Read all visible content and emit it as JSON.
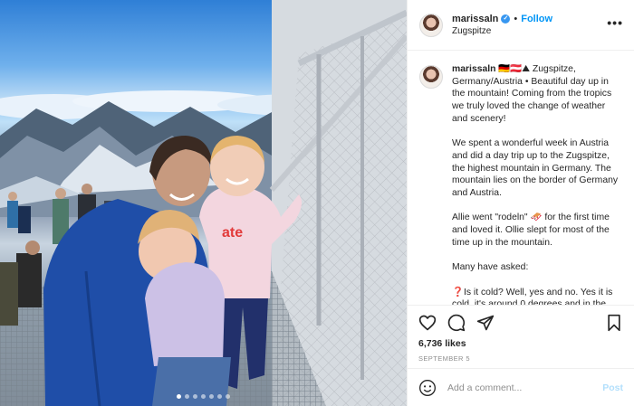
{
  "post": {
    "username": "marissaln",
    "location": "Zugspitze",
    "follow_label": "Follow",
    "separator": "•",
    "more_label": "•••",
    "caption_username": "marissaln",
    "caption_text": " 🇩🇪🇦🇹⛰ Zugspitze, Germany/Austria • Beautiful day up in the mountain! Coming from the tropics we truly loved the change of weather and scenery!\n\nWe spent a wonderful week in Austria and did a day trip up to the Zugspitze, the highest mountain in Germany. The mountain lies on the border of Germany and Austria.\n\nAllie went \"rodeln\" 🛷 for the first time and loved it. Ollie slept for most of the time up in the mountain.\n\nMany have asked:\n\n❓Is it cold? Well, yes and no. Yes it is cold, it's around 0 degrees and in the",
    "likes": "6,736 likes",
    "date": "SEPTEMBER 5",
    "comment_placeholder": "Add a comment...",
    "post_label": "Post"
  },
  "carousel": {
    "count": 7,
    "active_index": 0
  },
  "colors": {
    "accent": "#0095f6",
    "verified": "#3897f0",
    "post_disabled": "#b2dffc",
    "muted": "#8e8e8e"
  }
}
